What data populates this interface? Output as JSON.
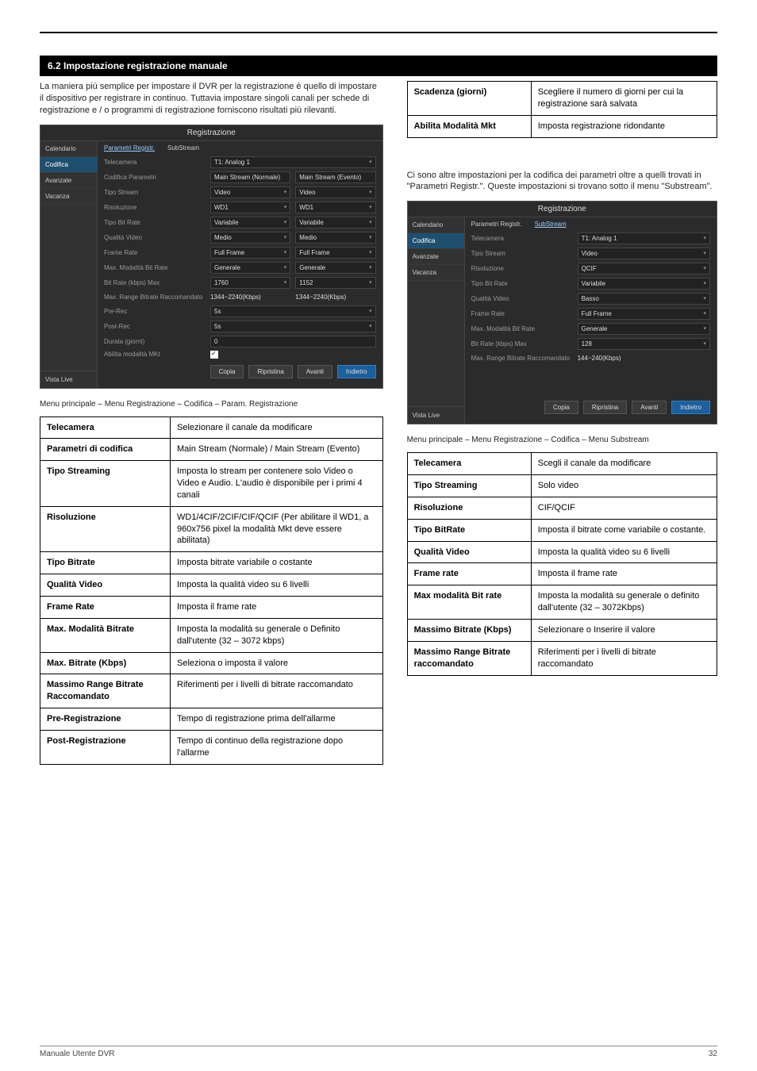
{
  "section_title": "6.2 Impostazione registrazione manuale",
  "intro_para": "La maniera più semplice per impostare il DVR per la registrazione è quello di impostare il dispositivo per registrare in continuo. Tuttavia impostare singoli canali per schede di registrazione e / o programmi di registrazione forniscono risultati più rilevanti.",
  "right_top_table": [
    {
      "k": "Scadenza (giorni)",
      "v": "Scegliere il numero di giorni per cui la registrazione sarà salvata"
    },
    {
      "k": "Abilita Modalità Mkt",
      "v": "Imposta registrazione ridondante"
    }
  ],
  "right_para": "Ci sono altre impostazioni per la codifica dei parametri oltre a quelli trovati in \"Parametri Registr.\". Queste impostazioni si trovano sotto il menu \"Substream\".",
  "shot": {
    "title": "Registrazione",
    "sidebar": [
      "Calendario",
      "Codifica",
      "Avanzate",
      "Vacanza"
    ],
    "sidebar_active": 1,
    "bottom": "Vista Live",
    "tabs_main": [
      "Parametri Registr.",
      "SubStream"
    ],
    "tabs_main_active": 0,
    "tabs_sub_active": 1,
    "rows_main": [
      {
        "lbl": "Telecamera",
        "v1": "T1: Analog 1",
        "span": true
      },
      {
        "lbl": "Codifica Parametri",
        "v1": "Main Stream (Normale)",
        "v2": "Main Stream (Evento)"
      },
      {
        "lbl": "Tipo Stream",
        "v1": "Video",
        "v2": "Video"
      },
      {
        "lbl": "Risoluzione",
        "v1": "WD1",
        "v2": "WD1"
      },
      {
        "lbl": "Tipo Bit Rate",
        "v1": "Variabile",
        "v2": "Variabile"
      },
      {
        "lbl": "Qualità Video",
        "v1": "Medio",
        "v2": "Medio"
      },
      {
        "lbl": "Frame Rate",
        "v1": "Full Frame",
        "v2": "Full Frame"
      },
      {
        "lbl": "Max. Modalità Bit Rate",
        "v1": "Generale",
        "v2": "Generale"
      },
      {
        "lbl": "Bit Rate (kbps) Max",
        "v1": "1760",
        "v2": "1152"
      },
      {
        "lbl": "Max. Range Bitrate Raccomandato",
        "v1": "1344~2240(Kbps)",
        "v2": "1344~2240(Kbps)",
        "plain": true
      },
      {
        "lbl": "Pre-Rec",
        "v1": "5s",
        "span": true
      },
      {
        "lbl": "Post-Rec",
        "v1": "5s",
        "span": true
      },
      {
        "lbl": "Durata (giorni)",
        "v1": "0",
        "span": true
      },
      {
        "lbl": "Abilita modalità MKt",
        "chk": true,
        "span": true
      }
    ],
    "rows_sub": [
      {
        "lbl": "Telecamera",
        "v1": "T1: Analog 1"
      },
      {
        "lbl": "Tipo Stream",
        "v1": "Video"
      },
      {
        "lbl": "Risoluzione",
        "v1": "QCIF"
      },
      {
        "lbl": "Tipo Bit Rate",
        "v1": "Variabile"
      },
      {
        "lbl": "Qualità Video",
        "v1": "Basso"
      },
      {
        "lbl": "Frame Rate",
        "v1": "Full Frame"
      },
      {
        "lbl": "Max. Modalità Bit Rate",
        "v1": "Generale"
      },
      {
        "lbl": "Bit Rate (kbps) Max",
        "v1": "128"
      },
      {
        "lbl": "Max. Range Bitrate Raccomandato",
        "v1": "144~240(Kbps)",
        "plain": true
      }
    ],
    "buttons": [
      "Copia",
      "Ripristina",
      "Avanti",
      "Indietro"
    ]
  },
  "caption_left": "Menu principale – Menu Registrazione – Codifica – Param. Registrazione",
  "caption_right": "Menu principale  – Menu Registrazione – Codifica – Menu Substream",
  "table_left": [
    {
      "k": "Telecamera",
      "v": "Selezionare il canale da modificare"
    },
    {
      "k": "Parametri di codifica",
      "v": "Main Stream (Normale) / Main Stream (Evento)"
    },
    {
      "k": "Tipo Streaming",
      "v": "Imposta lo stream per contenere solo Video o Video e Audio. L'audio è disponibile per i primi 4 canali"
    },
    {
      "k": "Risoluzione",
      "v": "WD1/4CIF/2CIF/CIF/QCIF (Per abilitare il WD1, a 960x756 pixel la modalità Mkt deve essere abilitata)"
    },
    {
      "k": "Tipo Bitrate",
      "v": "Imposta bitrate variabile o costante"
    },
    {
      "k": "Qualità Video",
      "v": "Imposta la qualità video su 6 livelli"
    },
    {
      "k": "Frame Rate",
      "v": "Imposta il frame rate"
    },
    {
      "k": "Max. Modalità Bitrate",
      "v": "Imposta la modalità su generale o Definito dall'utente (32 – 3072 kbps)"
    },
    {
      "k": "Max. Bitrate (Kbps)",
      "v": "Seleziona o imposta il valore"
    },
    {
      "k": "Massimo Range Bitrate Raccomandato",
      "v": "Riferimenti per i livelli di bitrate raccomandato"
    },
    {
      "k": "Pre-Registrazione",
      "v": "Tempo di registrazione prima dell'allarme"
    },
    {
      "k": "Post-Registrazione",
      "v": "Tempo di continuo della registrazione dopo l'allarme"
    }
  ],
  "table_right": [
    {
      "k": "Telecamera",
      "v": "Scegli il canale da modificare"
    },
    {
      "k": "Tipo Streaming",
      "v": "Solo video"
    },
    {
      "k": "Risoluzione",
      "v": "CIF/QCIF"
    },
    {
      "k": "Tipo BitRate",
      "v": "Imposta il bitrate come variabile o costante."
    },
    {
      "k": "Qualità Video",
      "v": "Imposta la qualità video su 6 livelli"
    },
    {
      "k": "Frame rate",
      "v": "Imposta il frame rate"
    },
    {
      "k": "Max modalità Bit rate",
      "v": "Imposta la modalità su generale o definito dall'utente (32 – 3072Kbps)"
    },
    {
      "k": "Massimo Bitrate (Kbps)",
      "v": "Selezionare o Inserire il valore"
    },
    {
      "k": "Massimo Range Bitrate raccomandato",
      "v": "Riferimenti per i livelli di bitrate raccomandato"
    }
  ],
  "footer_left": "Manuale Utente DVR",
  "footer_right": "32"
}
